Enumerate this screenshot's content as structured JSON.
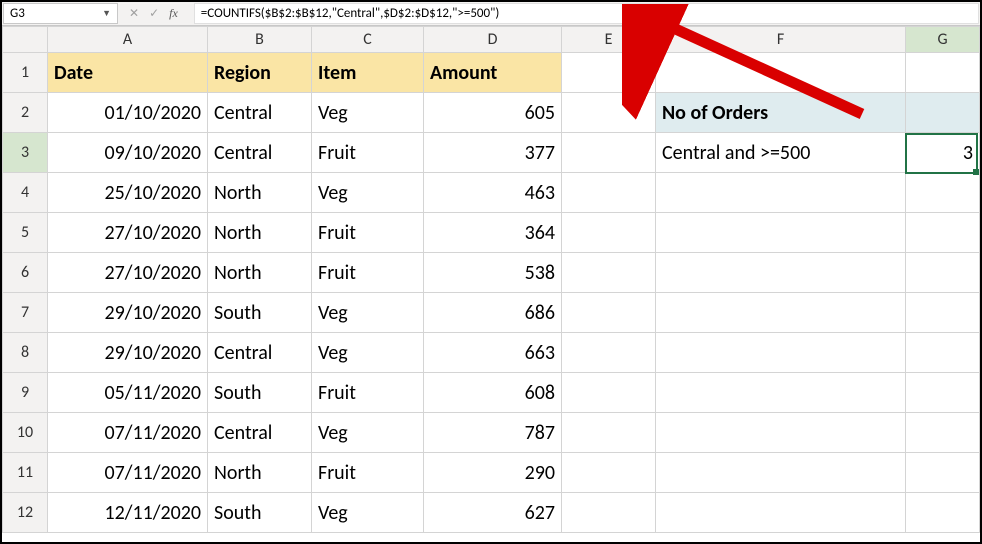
{
  "namebox": "G3",
  "formula": "=COUNTIFS($B$2:$B$12,\"Central\",$D$2:$D$12,\">=500\")",
  "columns": [
    "A",
    "B",
    "C",
    "D",
    "E",
    "F",
    "G"
  ],
  "headers": {
    "A": "Date",
    "B": "Region",
    "C": "Item",
    "D": "Amount"
  },
  "rows": [
    {
      "n": "1"
    },
    {
      "n": "2",
      "A": "01/10/2020",
      "B": "Central",
      "C": "Veg",
      "D": "605",
      "F": "No of Orders"
    },
    {
      "n": "3",
      "A": "09/10/2020",
      "B": "Central",
      "C": "Fruit",
      "D": "377",
      "F": "Central and >=500",
      "G": "3"
    },
    {
      "n": "4",
      "A": "25/10/2020",
      "B": "North",
      "C": "Veg",
      "D": "463"
    },
    {
      "n": "5",
      "A": "27/10/2020",
      "B": "North",
      "C": "Fruit",
      "D": "364"
    },
    {
      "n": "6",
      "A": "27/10/2020",
      "B": "North",
      "C": "Fruit",
      "D": "538"
    },
    {
      "n": "7",
      "A": "29/10/2020",
      "B": "South",
      "C": "Veg",
      "D": "686"
    },
    {
      "n": "8",
      "A": "29/10/2020",
      "B": "Central",
      "C": "Veg",
      "D": "663"
    },
    {
      "n": "9",
      "A": "05/11/2020",
      "B": "South",
      "C": "Fruit",
      "D": "608"
    },
    {
      "n": "10",
      "A": "07/11/2020",
      "B": "Central",
      "C": "Veg",
      "D": "787"
    },
    {
      "n": "11",
      "A": "07/11/2020",
      "B": "North",
      "C": "Fruit",
      "D": "290"
    },
    {
      "n": "12",
      "A": "12/11/2020",
      "B": "South",
      "C": "Veg",
      "D": "627"
    }
  ],
  "chart_data": {
    "type": "table",
    "title": "Orders table with COUNTIFS example",
    "columns": [
      "Date",
      "Region",
      "Item",
      "Amount"
    ],
    "data": [
      [
        "01/10/2020",
        "Central",
        "Veg",
        605
      ],
      [
        "09/10/2020",
        "Central",
        "Fruit",
        377
      ],
      [
        "25/10/2020",
        "North",
        "Veg",
        463
      ],
      [
        "27/10/2020",
        "North",
        "Fruit",
        364
      ],
      [
        "27/10/2020",
        "North",
        "Fruit",
        538
      ],
      [
        "29/10/2020",
        "South",
        "Veg",
        686
      ],
      [
        "29/10/2020",
        "Central",
        "Veg",
        663
      ],
      [
        "05/11/2020",
        "South",
        "Fruit",
        608
      ],
      [
        "07/11/2020",
        "Central",
        "Veg",
        787
      ],
      [
        "07/11/2020",
        "North",
        "Fruit",
        290
      ],
      [
        "12/11/2020",
        "South",
        "Veg",
        627
      ]
    ],
    "summary": {
      "label": "No of Orders",
      "criteria": "Central and >=500",
      "result": 3
    }
  }
}
